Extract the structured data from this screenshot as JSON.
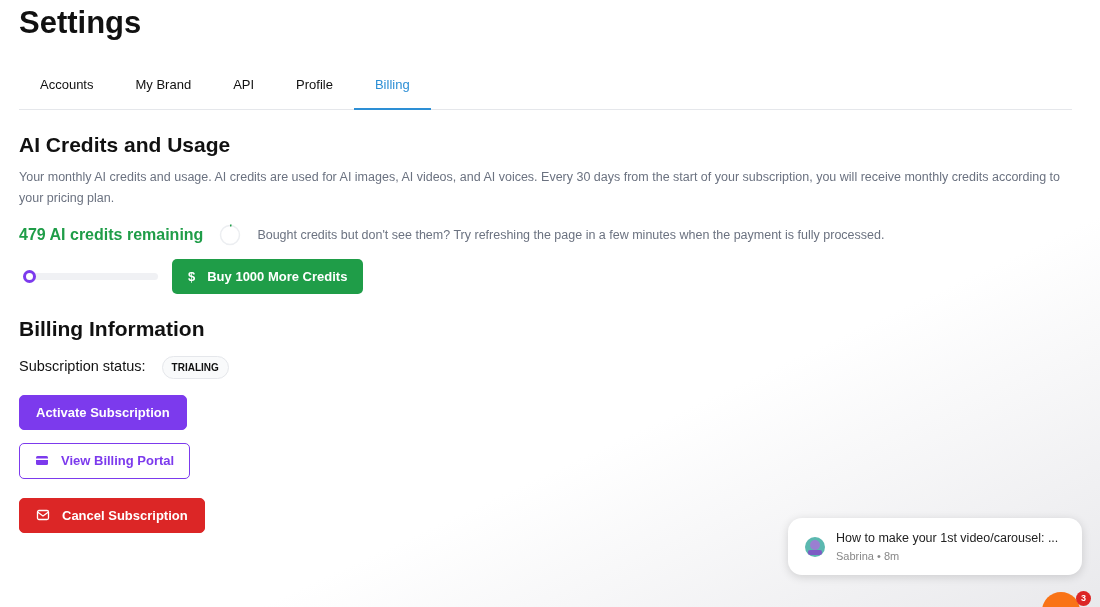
{
  "page_title": "Settings",
  "tabs": [
    {
      "label": "Accounts",
      "selected": false
    },
    {
      "label": "My Brand",
      "selected": false
    },
    {
      "label": "API",
      "selected": false
    },
    {
      "label": "Profile",
      "selected": false
    },
    {
      "label": "Billing",
      "selected": true
    }
  ],
  "credits": {
    "heading": "AI Credits and Usage",
    "description": "Your monthly AI credits and usage. AI credits are used for AI images, AI videos, and AI voices. Every 30 days from the start of your subscription, you will receive monthly credits according to your pricing plan.",
    "remaining": "479 AI credits remaining",
    "hint": "Bought credits but don't see them? Try refreshing the page in a few minutes when the payment is fully processed.",
    "level": 0.02,
    "buy_button": {
      "icon": "$",
      "label": "Buy 1000 More Credits"
    }
  },
  "billing": {
    "heading": "Billing Information",
    "status_label": "Subscription status:",
    "status": "TRIALING",
    "buttons": [
      {
        "kind": "primary",
        "label": "Activate Subscription"
      },
      {
        "kind": "outline",
        "label": "View Billing Portal"
      },
      {
        "kind": "danger",
        "label": "Cancel Subscription"
      }
    ]
  },
  "chat": {
    "message": "How to make your 1st video/carousel: ...",
    "sender": "Sabrina",
    "separator": "•",
    "time": "8m",
    "unread": "3"
  }
}
